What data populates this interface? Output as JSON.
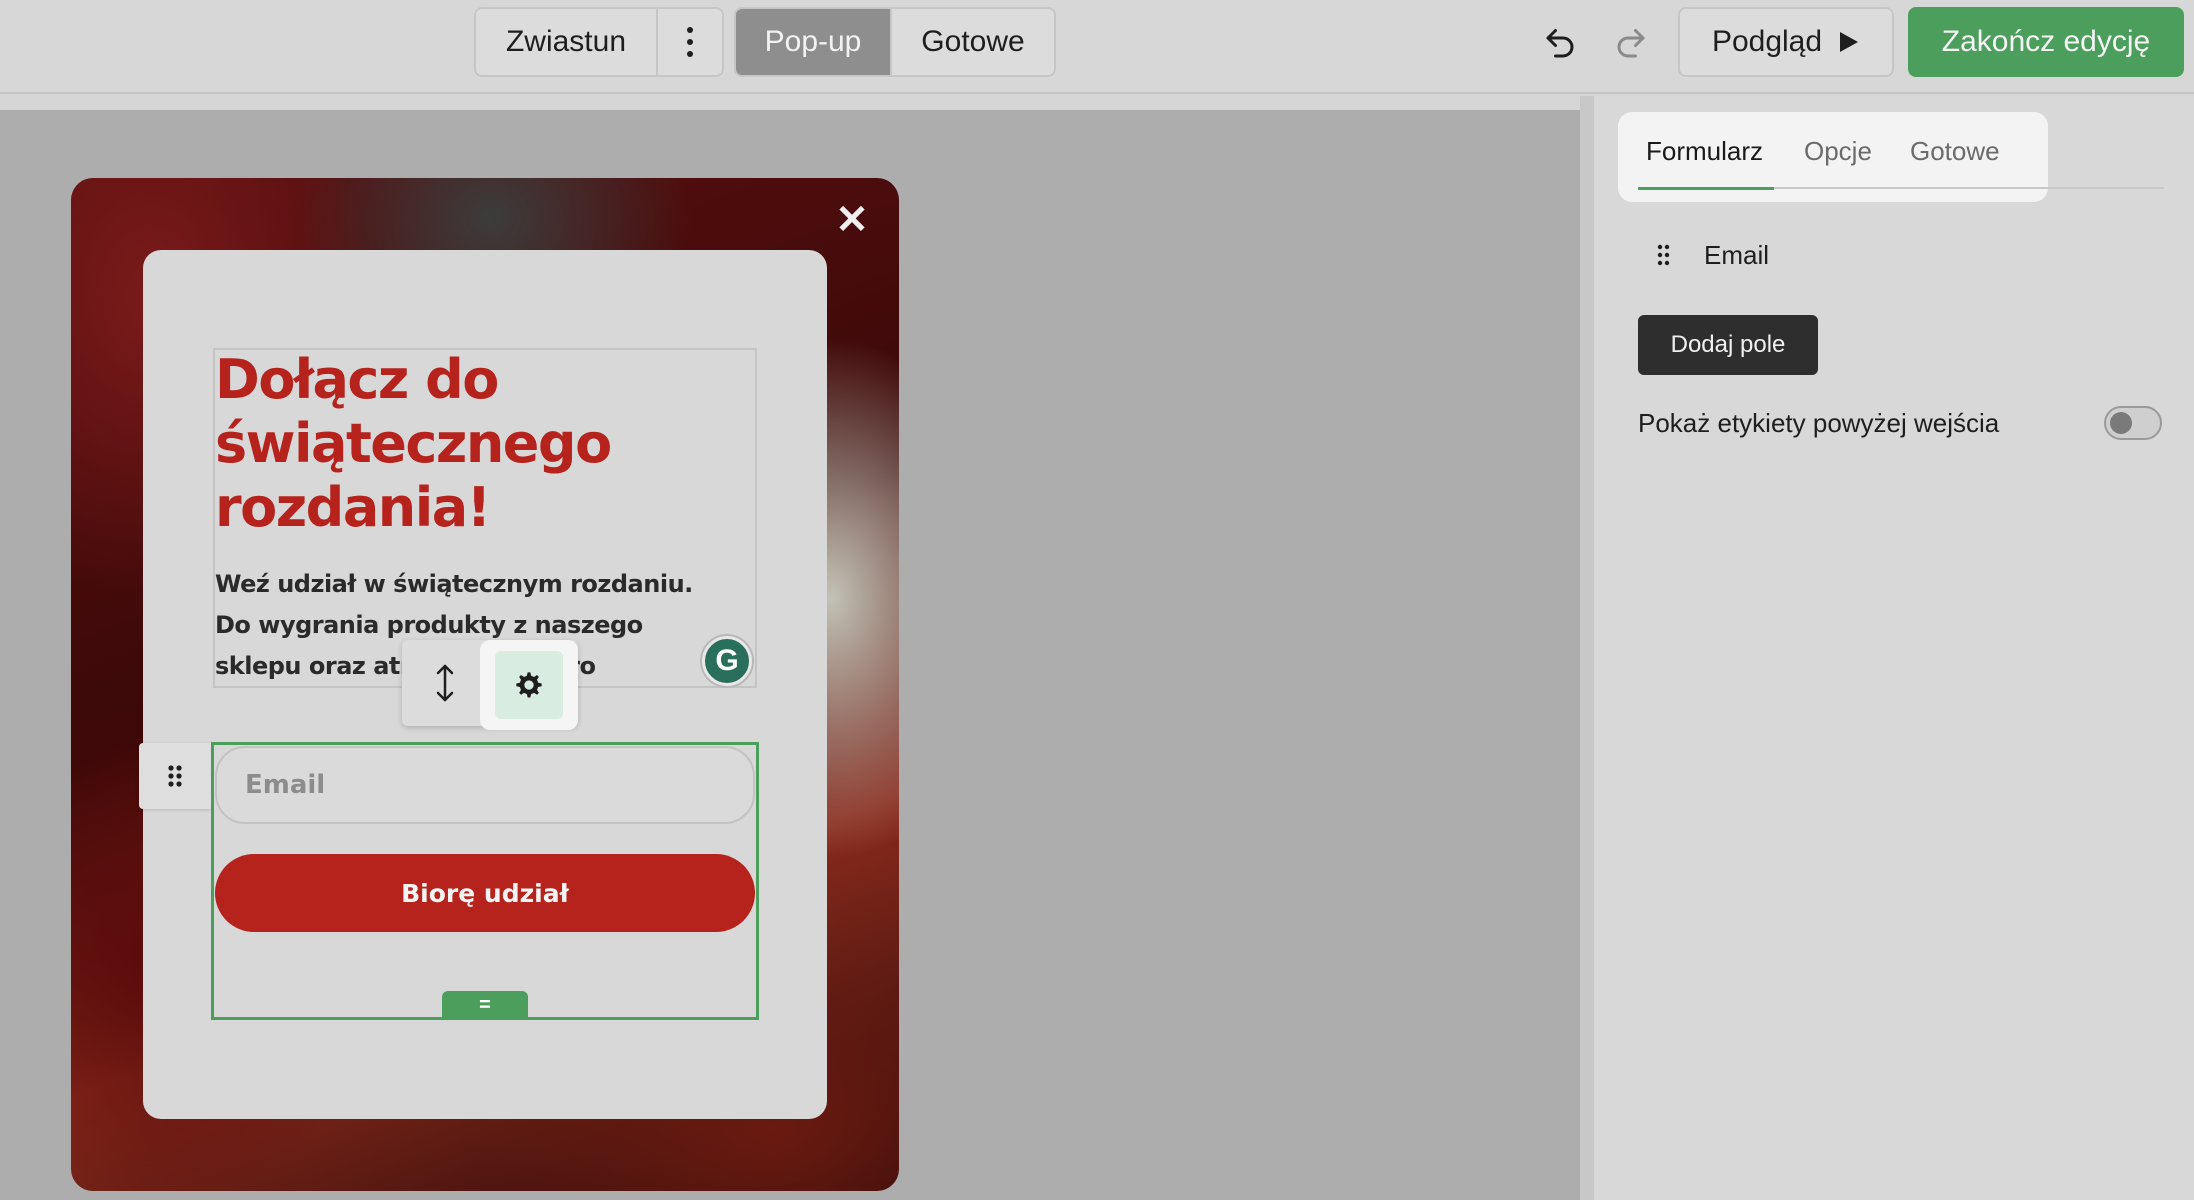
{
  "topbar": {
    "tabs": [
      {
        "label": "Zwiastun",
        "active": false
      },
      {
        "label": "Pop-up",
        "active": true
      },
      {
        "label": "Gotowe",
        "active": false
      }
    ],
    "more_icon": "kebab-vertical-icon",
    "undo_icon": "undo-icon",
    "redo_icon": "redo-icon",
    "preview_label": "Podgląd",
    "preview_icon": "play-icon",
    "finish_label": "Zakończ edycję",
    "accent_color": "#4c9e5c"
  },
  "popup": {
    "close_icon": "close-icon",
    "headline": "Dołącz do świątecznego rozdania!",
    "body": "Weź udział w świątecznym rozdaniu. Do wygrania produkty z naszego sklepu oraz atrakcyjne nagro",
    "headline_color": "#b5231c",
    "email_placeholder": "Email",
    "submit_label": "Biorę udział",
    "submit_color": "#b5231c",
    "bottom_handle_label": "="
  },
  "floating_toolbar": {
    "resize_icon": "resize-vertical-icon",
    "settings_icon": "gear-icon"
  },
  "extension_badge": "G",
  "panel": {
    "tabs": [
      {
        "label": "Formularz",
        "active": true
      },
      {
        "label": "Opcje",
        "active": false
      },
      {
        "label": "Gotowe",
        "active": false
      }
    ],
    "fields": [
      {
        "label": "Email"
      }
    ],
    "add_field_label": "Dodaj pole",
    "toggle_label": "Pokaż etykiety powyżej wejścia",
    "toggle_on": false
  }
}
